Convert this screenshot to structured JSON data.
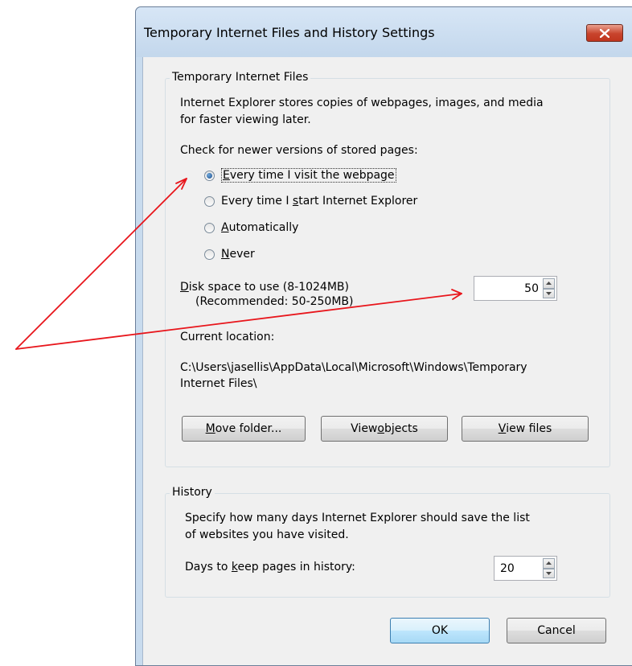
{
  "window": {
    "title": "Temporary Internet Files and History Settings",
    "close_icon": "close-icon"
  },
  "temp_files": {
    "legend": "Temporary Internet Files",
    "description_line1": "Internet Explorer stores copies of webpages, images, and media",
    "description_line2": "for faster viewing later.",
    "check_label": "Check for newer versions of stored pages:",
    "options": {
      "every_visit": {
        "pre": "",
        "accel": "E",
        "post": "very time I visit the webpage",
        "selected": true
      },
      "every_start": {
        "pre": "Every time I ",
        "accel": "s",
        "post": "tart Internet Explorer",
        "selected": false
      },
      "automatically": {
        "pre": "",
        "accel": "A",
        "post": "utomatically",
        "selected": false
      },
      "never": {
        "pre": "",
        "accel": "N",
        "post": "ever",
        "selected": false
      }
    },
    "disk_space_label_accel": "D",
    "disk_space_label_rest": "isk space to use (8-1024MB)",
    "disk_space_recommended": "(Recommended: 50-250MB)",
    "disk_space_value": "50",
    "current_location_label": "Current location:",
    "location_line1": "C:\\Users\\jasellis\\AppData\\Local\\Microsoft\\Windows\\Temporary",
    "location_line2": "Internet Files\\",
    "buttons": {
      "move_folder": {
        "accel": "M",
        "rest": "ove folder..."
      },
      "view_objects": {
        "pre": "View ",
        "accel": "o",
        "post": "bjects"
      },
      "view_files": {
        "accel": "V",
        "rest": "iew files"
      }
    }
  },
  "history": {
    "legend": "History",
    "description_line1": "Specify how many days Internet Explorer should save the list",
    "description_line2": "of websites you have visited.",
    "days_label_pre": "Days to ",
    "days_label_accel": "k",
    "days_label_post": "eep pages in history:",
    "days_value": "20"
  },
  "footer": {
    "ok_label": "OK",
    "cancel_label": "Cancel"
  },
  "annotation": {
    "arrow_color": "#e8161c"
  }
}
